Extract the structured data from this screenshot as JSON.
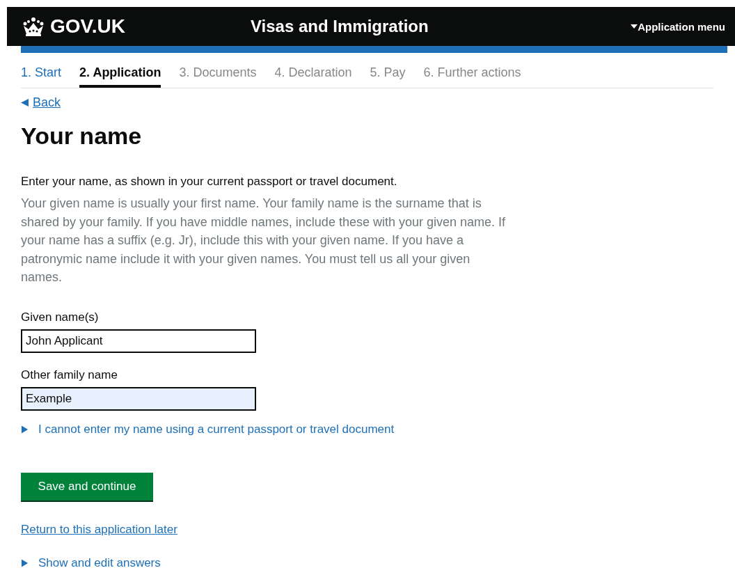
{
  "header": {
    "logo": "GOV.UK",
    "service": "Visas and Immigration",
    "menu": {
      "label": "Application menu",
      "expanded": false
    }
  },
  "steps": [
    {
      "label": "1. Start",
      "completed": true,
      "selected": false
    },
    {
      "label": "2. Application",
      "completed": false,
      "selected": true
    },
    {
      "label": "3. Documents",
      "completed": false,
      "selected": false
    },
    {
      "label": "4. Declaration",
      "completed": false,
      "selected": false
    },
    {
      "label": "5. Pay",
      "completed": false,
      "selected": false
    },
    {
      "label": "6. Further actions",
      "completed": false,
      "selected": false
    }
  ],
  "back_link": "Back",
  "heading": "Your name",
  "intro": "Enter your name, as shown in your current passport or travel document.",
  "hint": "Your given name is usually your first name. Your family name is the surname that is shared by your family. If you have middle names, include these with your given name. If your name has a suffix (e.g. Jr), include this with your given name. If you have a patronymic name include it with your given names. You must tell us all your given names.",
  "fields": [
    {
      "label": "Given name(s)",
      "value": "John Applicant",
      "autofilled": false
    },
    {
      "label": "Other family name",
      "value": "Example",
      "autofilled": true
    }
  ],
  "details": [
    {
      "summary": "I cannot enter my name using a current passport or travel document",
      "expanded": false
    }
  ],
  "submit_button": "Save and continue",
  "return_link": "Return to this application later",
  "answers_details": {
    "summary": "Show and edit answers",
    "expanded": false
  }
}
